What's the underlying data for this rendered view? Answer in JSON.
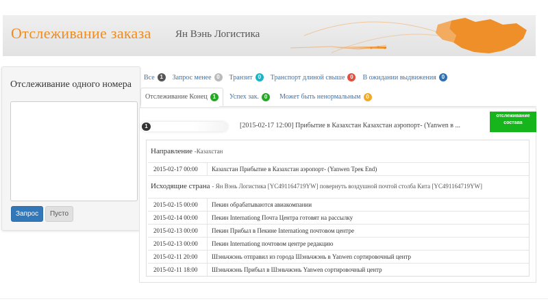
{
  "header": {
    "title": "Отслеживание заказа",
    "subtitle": "Ян Вэнь Логистика",
    "accent": "#f08c1e"
  },
  "left_panel": {
    "title": "Отслеживание одного номера",
    "textarea_value": "",
    "query_button": "Запрос",
    "clear_button": "Пусто"
  },
  "tabs_row1": [
    {
      "label": "Все",
      "count": "1",
      "color": "#555555",
      "active": false
    },
    {
      "label": "Запрос менее",
      "count": "0",
      "color": "#bbbbbb",
      "active": false
    },
    {
      "label": "Транзит",
      "count": "0",
      "color": "#1bb3c6",
      "active": false
    },
    {
      "label": "Транспорт длиной свыше",
      "count": "0",
      "color": "#e74c3c",
      "active": false
    },
    {
      "label": "В ожидании выдвижения",
      "count": "0",
      "color": "#2f6fb3",
      "active": false
    }
  ],
  "tabs_row2": [
    {
      "label": "Отслеживание Конец",
      "count": "1",
      "color": "#26a826",
      "active": true
    },
    {
      "label": "Успех зак.",
      "count": "0",
      "color": "#26a826",
      "active": false
    },
    {
      "label": "Может быть ненормальным",
      "count": "0",
      "color": "#f0a92a",
      "active": false
    }
  ],
  "tracking": {
    "index": "1",
    "last_event": "[2015-02-17 12:00] Прибытие в Казахстан Казахстан аэропорт- (Yanwen в ...",
    "status_label": "отслеживание состава",
    "status_color": "#15b51b",
    "destination_label": "Направление",
    "destination_value": "-Казахстан",
    "destination_events": [
      {
        "date": "2015-02-17 00:00",
        "text": "Казахстан Прибытие в Казахстан аэропорт- (Yanwen Трек End)"
      }
    ],
    "origin_label": "Исходящие страна",
    "origin_value": "- Ян Вэнь Логистика [YC491164719YW] повернуть воздушной почтой столба Кита [YC491164719YW]",
    "origin_events": [
      {
        "date": "2015-02-15 00:00",
        "text": "Пекин обрабатываются авиакомпании"
      },
      {
        "date": "2015-02-14 00:00",
        "text": "Пекин Internationg Почта Центра готовят на рассылку"
      },
      {
        "date": "2015-02-13 00:00",
        "text": "Пекин Прибыл в Пекине Internationg почтовом центре"
      },
      {
        "date": "2015-02-13 00:00",
        "text": "Пекин Internationg почтовом центре редакцию"
      },
      {
        "date": "2015-02-11 20:00",
        "text": "Шэньчжэнь отправил из города Шэньчжэнь в Yanwen сортировочный центр"
      },
      {
        "date": "2015-02-11 18:00",
        "text": "Шэньчжэнь Прибыл в Шэньчжэнь Yanwen сортировочный центр"
      }
    ]
  }
}
